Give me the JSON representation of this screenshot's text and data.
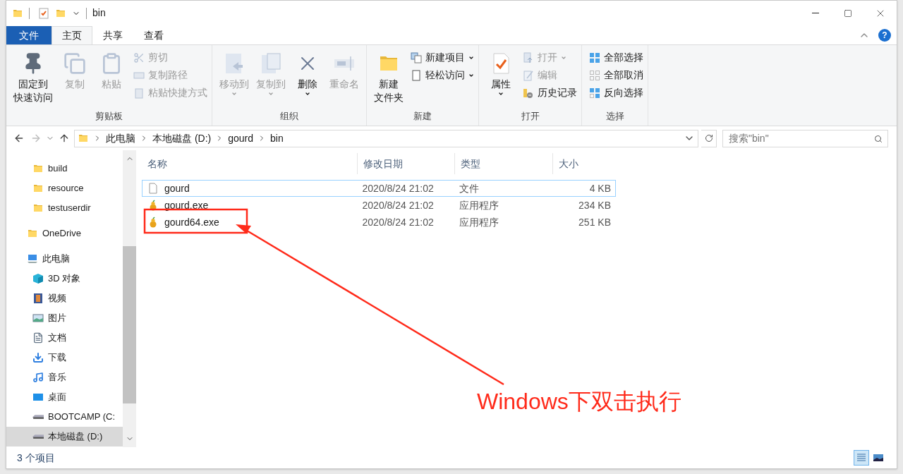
{
  "window": {
    "title": "bin"
  },
  "ribbon_tabs": [
    {
      "label": "文件",
      "kind": "file",
      "selected": false
    },
    {
      "label": "主页",
      "kind": "tab",
      "selected": true
    },
    {
      "label": "共享",
      "kind": "tab",
      "selected": false
    },
    {
      "label": "查看",
      "kind": "tab",
      "selected": false
    }
  ],
  "help_button": "?",
  "ribbon_groups": [
    {
      "label": "剪贴板",
      "items": [
        {
          "lines": [
            "固定到",
            "快速访问"
          ],
          "kind": "large",
          "disabled": false,
          "dropdown": false
        },
        {
          "lines": [
            "复制"
          ],
          "kind": "large",
          "disabled": true,
          "dropdown": false
        },
        {
          "lines": [
            "粘贴"
          ],
          "kind": "large",
          "disabled": true,
          "dropdown": false
        },
        {
          "label": "剪切",
          "kind": "small",
          "disabled": true,
          "dropdown": false
        },
        {
          "label": "复制路径",
          "kind": "small",
          "disabled": true,
          "dropdown": false
        },
        {
          "label": "粘贴快捷方式",
          "kind": "small",
          "disabled": true,
          "dropdown": false
        }
      ]
    },
    {
      "label": "组织",
      "items": [
        {
          "lines": [
            "移动到"
          ],
          "kind": "large",
          "disabled": true,
          "dropdown": true
        },
        {
          "lines": [
            "复制到"
          ],
          "kind": "large",
          "disabled": true,
          "dropdown": true
        },
        {
          "lines": [
            "删除"
          ],
          "kind": "large",
          "disabled": false,
          "dropdown": true
        },
        {
          "lines": [
            "重命名"
          ],
          "kind": "large",
          "disabled": true,
          "dropdown": false
        }
      ]
    },
    {
      "label": "新建",
      "items": [
        {
          "lines": [
            "新建",
            "文件夹"
          ],
          "kind": "large",
          "disabled": false,
          "dropdown": false
        },
        {
          "label": "新建项目",
          "kind": "small",
          "disabled": false,
          "dropdown": true
        },
        {
          "label": "轻松访问",
          "kind": "small",
          "disabled": false,
          "dropdown": true
        }
      ]
    },
    {
      "label": "打开",
      "items": [
        {
          "lines": [
            "属性"
          ],
          "kind": "large",
          "disabled": false,
          "dropdown": true
        },
        {
          "label": "打开",
          "kind": "small",
          "disabled": true,
          "dropdown": true
        },
        {
          "label": "编辑",
          "kind": "small",
          "disabled": true,
          "dropdown": false
        },
        {
          "label": "历史记录",
          "kind": "small",
          "disabled": false,
          "dropdown": false
        }
      ]
    },
    {
      "label": "选择",
      "items": [
        {
          "label": "全部选择",
          "kind": "small",
          "disabled": false,
          "dropdown": false
        },
        {
          "label": "全部取消",
          "kind": "small",
          "disabled": false,
          "dropdown": false
        },
        {
          "label": "反向选择",
          "kind": "small",
          "disabled": false,
          "dropdown": false
        }
      ]
    }
  ],
  "address": {
    "crumbs": [
      "此电脑",
      "本地磁盘 (D:)",
      "gourd",
      "bin"
    ]
  },
  "search": {
    "placeholder": "搜索\"bin\""
  },
  "nav": [
    {
      "children": [
        {
          "label": "build",
          "kind": "folder",
          "selected": false
        },
        {
          "label": "resource",
          "kind": "folder",
          "selected": false
        },
        {
          "label": "testuserdir",
          "kind": "folder",
          "selected": false
        }
      ]
    },
    {
      "label": "OneDrive",
      "kind": "folder",
      "selected": false
    },
    {
      "label": "此电脑",
      "kind": "pc",
      "selected": false,
      "children": [
        {
          "label": "3D 对象",
          "kind": "cube",
          "selected": false
        },
        {
          "label": "视频",
          "kind": "video",
          "selected": false
        },
        {
          "label": "图片",
          "kind": "picture",
          "selected": false
        },
        {
          "label": "文档",
          "kind": "document",
          "selected": false
        },
        {
          "label": "下载",
          "kind": "download",
          "selected": false
        },
        {
          "label": "音乐",
          "kind": "music",
          "selected": false
        },
        {
          "label": "桌面",
          "kind": "desktop",
          "selected": false
        },
        {
          "label": "BOOTCAMP (C:",
          "kind": "drive",
          "selected": false
        },
        {
          "label": "本地磁盘 (D:)",
          "kind": "drive",
          "selected": true
        }
      ]
    }
  ],
  "table": {
    "columns": [
      "名称",
      "修改日期",
      "类型",
      "大小"
    ],
    "rows": [
      {
        "name": "gourd",
        "date": "2020/8/24 21:02",
        "type": "文件",
        "size": "4 KB",
        "kind": "file",
        "focused": true
      },
      {
        "name": "gourd.exe",
        "date": "2020/8/24 21:02",
        "type": "应用程序",
        "size": "234 KB",
        "kind": "exe",
        "focused": false
      },
      {
        "name": "gourd64.exe",
        "date": "2020/8/24 21:02",
        "type": "应用程序",
        "size": "251 KB",
        "kind": "exe",
        "focused": false
      }
    ]
  },
  "status_bar": {
    "count": "3 个项目",
    "views": [
      {
        "kind": "details",
        "selected": true
      },
      {
        "kind": "large",
        "selected": false
      }
    ]
  },
  "annotation": {
    "text": "Windows下双击执行"
  }
}
